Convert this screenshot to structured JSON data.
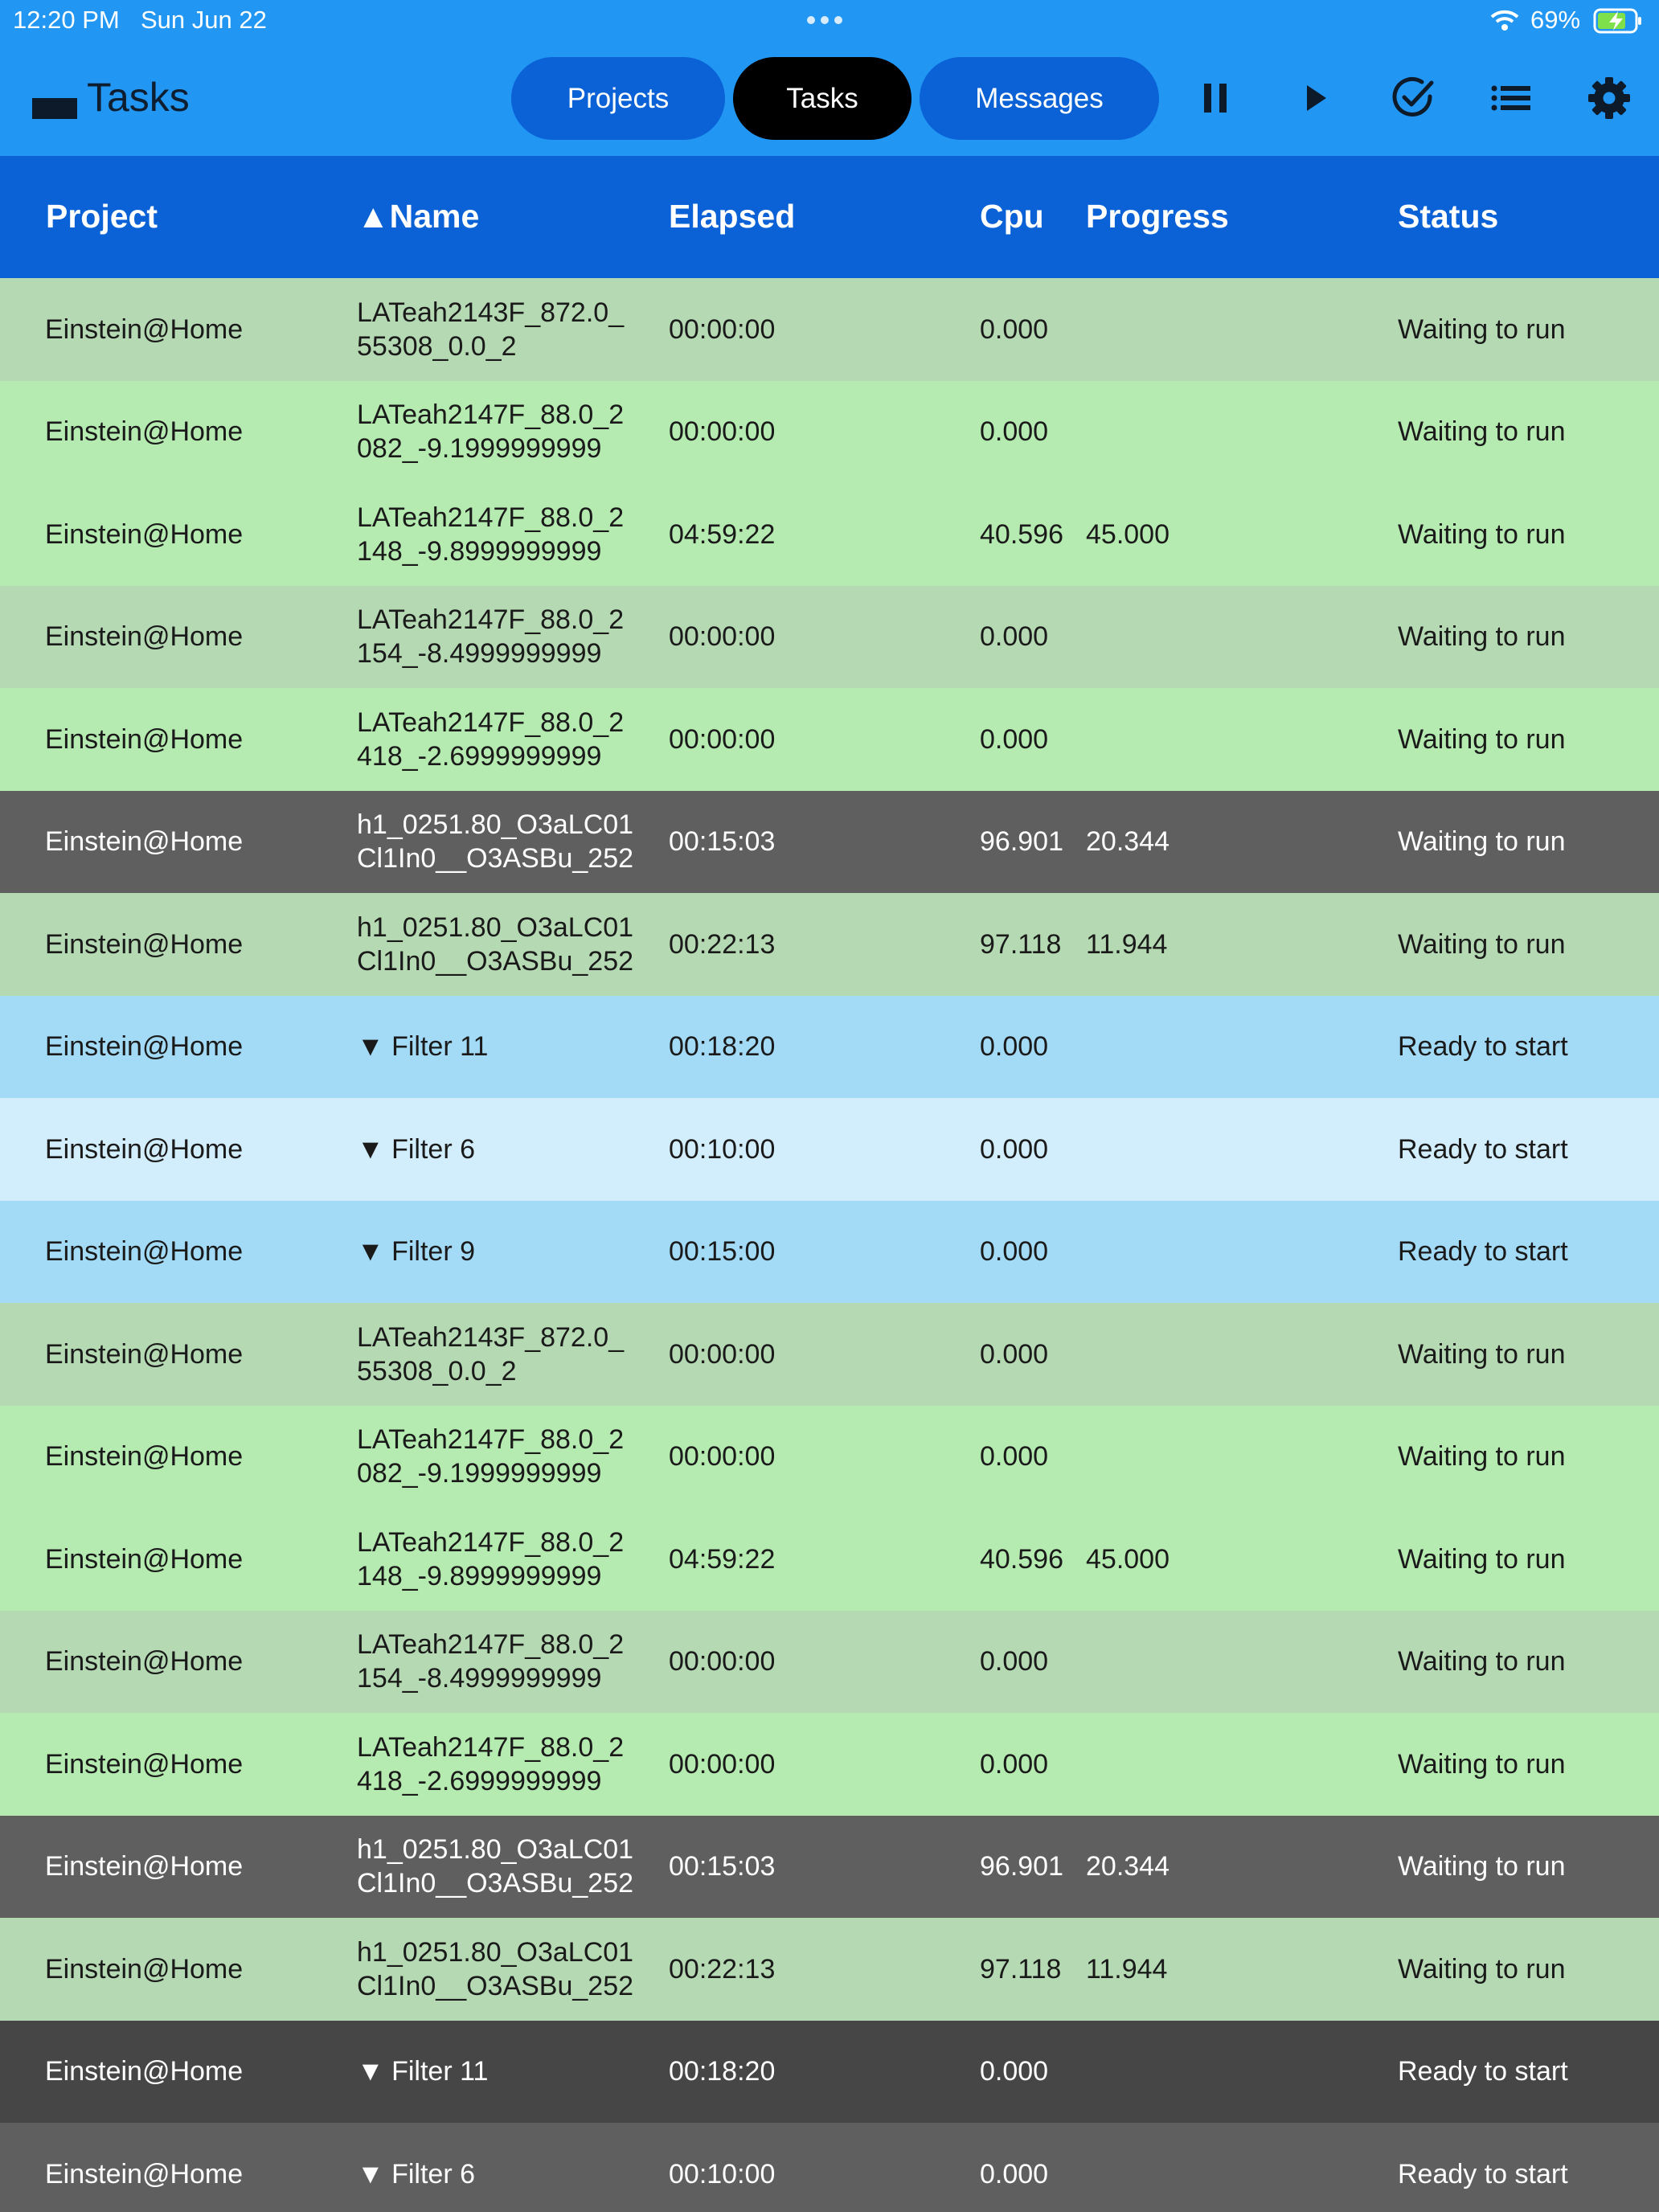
{
  "status_bar": {
    "time": "12:20 PM",
    "date": "Sun Jun 22",
    "battery": "69%"
  },
  "app": {
    "title": "Tasks"
  },
  "nav": {
    "projects": "Projects",
    "tasks": "Tasks",
    "messages": "Messages"
  },
  "toolbar_icons": [
    "pause-icon",
    "play-icon",
    "check-circle-icon",
    "list-icon",
    "gear-icon"
  ],
  "colors": {
    "accent": "#2196f3",
    "header": "#0a62d6",
    "row_sage": "#b5dab3",
    "row_mint": "#b5ebb0",
    "row_gray": "#5f5f5f",
    "row_dark": "#464646",
    "row_blue": "#a3daf5",
    "row_light_blue": "#d2edfb"
  },
  "table": {
    "columns": [
      "Project",
      "▲Name",
      "Elapsed",
      "Cpu",
      "Progress",
      "Status"
    ],
    "rows": [
      {
        "project": "Einstein@Home",
        "name": [
          "LATeah2143F_872.0_",
          "55308_0.0_2"
        ],
        "elapsed": "00:00:00",
        "cpu": "0.000",
        "progress": "",
        "status": "Waiting to run",
        "color": "sage"
      },
      {
        "project": "Einstein@Home",
        "name": [
          "LATeah2147F_88.0_2",
          "082_-9.1999999999"
        ],
        "elapsed": "00:00:00",
        "cpu": "0.000",
        "progress": "",
        "status": "Waiting to run",
        "color": "mint"
      },
      {
        "project": "Einstein@Home",
        "name": [
          "LATeah2147F_88.0_2",
          "148_-9.8999999999"
        ],
        "elapsed": "04:59:22",
        "cpu": "40.596",
        "progress": "45.000",
        "status": "Waiting to run",
        "color": "mint"
      },
      {
        "project": "Einstein@Home",
        "name": [
          "LATeah2147F_88.0_2",
          "154_-8.4999999999"
        ],
        "elapsed": "00:00:00",
        "cpu": "0.000",
        "progress": "",
        "status": "Waiting to run",
        "color": "sage"
      },
      {
        "project": "Einstein@Home",
        "name": [
          "LATeah2147F_88.0_2",
          "418_-2.6999999999"
        ],
        "elapsed": "00:00:00",
        "cpu": "0.000",
        "progress": "",
        "status": "Waiting to run",
        "color": "mint"
      },
      {
        "project": "Einstein@Home",
        "name": [
          "h1_0251.80_O3aLC01",
          "Cl1In0__O3ASBu_252"
        ],
        "elapsed": "00:15:03",
        "cpu": "96.901",
        "progress": "20.344",
        "status": "Waiting to run",
        "color": "gray"
      },
      {
        "project": "Einstein@Home",
        "name": [
          "h1_0251.80_O3aLC01",
          "Cl1In0__O3ASBu_252"
        ],
        "elapsed": "00:22:13",
        "cpu": "97.118",
        "progress": "11.944",
        "status": "Waiting to run",
        "color": "sage"
      },
      {
        "project": "Einstein@Home",
        "name": [
          "▼ Filter 11"
        ],
        "elapsed": "00:18:20",
        "cpu": "0.000",
        "progress": "",
        "status": "Ready to start",
        "color": "blue"
      },
      {
        "project": "Einstein@Home",
        "name": [
          "▼ Filter 6"
        ],
        "elapsed": "00:10:00",
        "cpu": "0.000",
        "progress": "",
        "status": "Ready to start",
        "color": "lblue"
      },
      {
        "project": "Einstein@Home",
        "name": [
          "▼ Filter 9"
        ],
        "elapsed": "00:15:00",
        "cpu": "0.000",
        "progress": "",
        "status": "Ready to start",
        "color": "blue"
      },
      {
        "project": "Einstein@Home",
        "name": [
          "LATeah2143F_872.0_",
          "55308_0.0_2"
        ],
        "elapsed": "00:00:00",
        "cpu": "0.000",
        "progress": "",
        "status": "Waiting to run",
        "color": "sage"
      },
      {
        "project": "Einstein@Home",
        "name": [
          "LATeah2147F_88.0_2",
          "082_-9.1999999999"
        ],
        "elapsed": "00:00:00",
        "cpu": "0.000",
        "progress": "",
        "status": "Waiting to run",
        "color": "mint"
      },
      {
        "project": "Einstein@Home",
        "name": [
          "LATeah2147F_88.0_2",
          "148_-9.8999999999"
        ],
        "elapsed": "04:59:22",
        "cpu": "40.596",
        "progress": "45.000",
        "status": "Waiting to run",
        "color": "mint"
      },
      {
        "project": "Einstein@Home",
        "name": [
          "LATeah2147F_88.0_2",
          "154_-8.4999999999"
        ],
        "elapsed": "00:00:00",
        "cpu": "0.000",
        "progress": "",
        "status": "Waiting to run",
        "color": "sage"
      },
      {
        "project": "Einstein@Home",
        "name": [
          "LATeah2147F_88.0_2",
          "418_-2.6999999999"
        ],
        "elapsed": "00:00:00",
        "cpu": "0.000",
        "progress": "",
        "status": "Waiting to run",
        "color": "mint"
      },
      {
        "project": "Einstein@Home",
        "name": [
          "h1_0251.80_O3aLC01",
          "Cl1In0__O3ASBu_252"
        ],
        "elapsed": "00:15:03",
        "cpu": "96.901",
        "progress": "20.344",
        "status": "Waiting to run",
        "color": "gray"
      },
      {
        "project": "Einstein@Home",
        "name": [
          "h1_0251.80_O3aLC01",
          "Cl1In0__O3ASBu_252"
        ],
        "elapsed": "00:22:13",
        "cpu": "97.118",
        "progress": "11.944",
        "status": "Waiting to run",
        "color": "sage"
      },
      {
        "project": "Einstein@Home",
        "name": [
          "▼ Filter 11"
        ],
        "elapsed": "00:18:20",
        "cpu": "0.000",
        "progress": "",
        "status": "Ready to start",
        "color": "dark"
      },
      {
        "project": "Einstein@Home",
        "name": [
          "▼ Filter 6"
        ],
        "elapsed": "00:10:00",
        "cpu": "0.000",
        "progress": "",
        "status": "Ready to start",
        "color": "gray"
      }
    ]
  }
}
